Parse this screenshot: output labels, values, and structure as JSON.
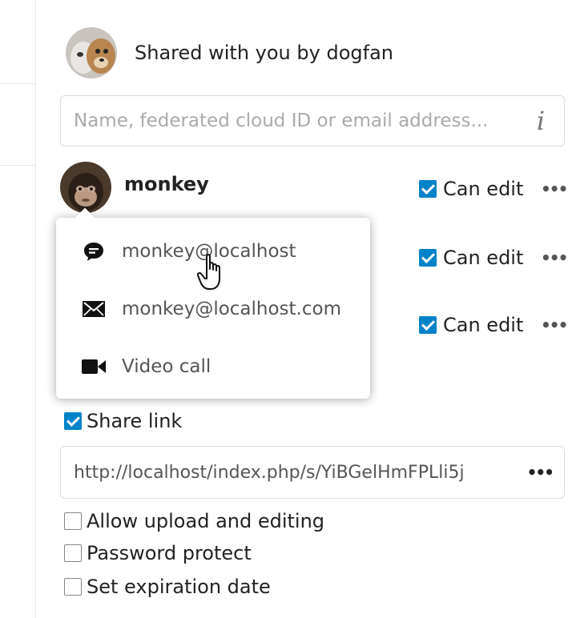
{
  "owner": {
    "text": "Shared with you by dogfan",
    "avatar_icon": "dog-cat-avatar"
  },
  "share_search": {
    "placeholder": "Name, federated cloud ID or email address...",
    "value": "",
    "info_icon": "info-icon"
  },
  "sharees": [
    {
      "name": "monkey",
      "permission_label": "Can edit",
      "can_edit": true
    },
    {
      "name": "",
      "permission_label": "Can edit",
      "can_edit": true
    },
    {
      "name": "",
      "permission_label": "Can edit",
      "can_edit": true
    }
  ],
  "contact_menu": {
    "items": [
      {
        "icon": "talk-bubble-icon",
        "label": "monkey@localhost"
      },
      {
        "icon": "mail-icon",
        "label": "monkey@localhost.com"
      },
      {
        "icon": "video-icon",
        "label": "Video call"
      }
    ]
  },
  "share_link": {
    "label": "Share link",
    "enabled": true,
    "url": "http://localhost/index.php/s/YiBGelHmFPLli5j"
  },
  "options": [
    {
      "label": "Allow upload and editing",
      "checked": false
    },
    {
      "label": "Password protect",
      "checked": false
    },
    {
      "label": "Set expiration date",
      "checked": false
    }
  ],
  "colors": {
    "accent": "#0082c9",
    "border": "#dbdbdb",
    "muted_text": "#555555"
  }
}
